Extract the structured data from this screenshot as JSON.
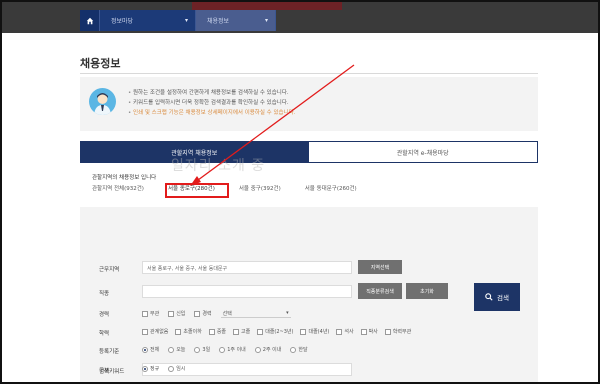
{
  "nav": {
    "home_icon": "home-icon",
    "menu1": "정보마당",
    "menu2": "채용정보"
  },
  "page": {
    "title": "채용정보",
    "info_lines": [
      "원하는 조건을 설정하여 간편하게 채용정보를 검색하실 수 있습니다.",
      "키워드를 입력하시면 더욱 정확한 검색결과를 확인하실 수 있습니다.",
      "인쇄 및 스크랩 기능은 채용정보 상세페이지에서 이용하실 수 있습니다."
    ],
    "tabs": [
      "관할지역 채용정보",
      "관할지역 e-채용마당"
    ],
    "watermark": "일자리 소개 중",
    "district_label": "관할지역의 채용정보 입니다",
    "districts": [
      "관할지역 전체(932건)",
      "서울 종로구(280건)",
      "서울 중구(392건)",
      "서울 동대문구(260건)"
    ]
  },
  "form": {
    "work_area_label": "근무지역",
    "work_area_value": "서울 종로구, 서울 중구, 서울 동대문구",
    "area_button": "지역선택",
    "job_label": "직종",
    "job_button": "직종분류검색",
    "job_reset": "초기화",
    "career_label": "경력",
    "career_options": [
      "무관",
      "신입",
      "경력"
    ],
    "career_select": "선택",
    "edu_label": "학력",
    "edu_options": [
      "관계없음",
      "초졸이하",
      "중졸",
      "고졸",
      "대졸(2~3년)",
      "대졸(4년)",
      "석사",
      "박사",
      "학력무관"
    ],
    "date_label": "등록기준",
    "date_options": [
      "전체",
      "오늘",
      "3일",
      "1주 이내",
      "2주 이내",
      "한달"
    ],
    "keyword_label": "검색키워드",
    "type_label": "구분",
    "type_options": [
      "정규",
      "임시"
    ],
    "search_button": "검색"
  }
}
